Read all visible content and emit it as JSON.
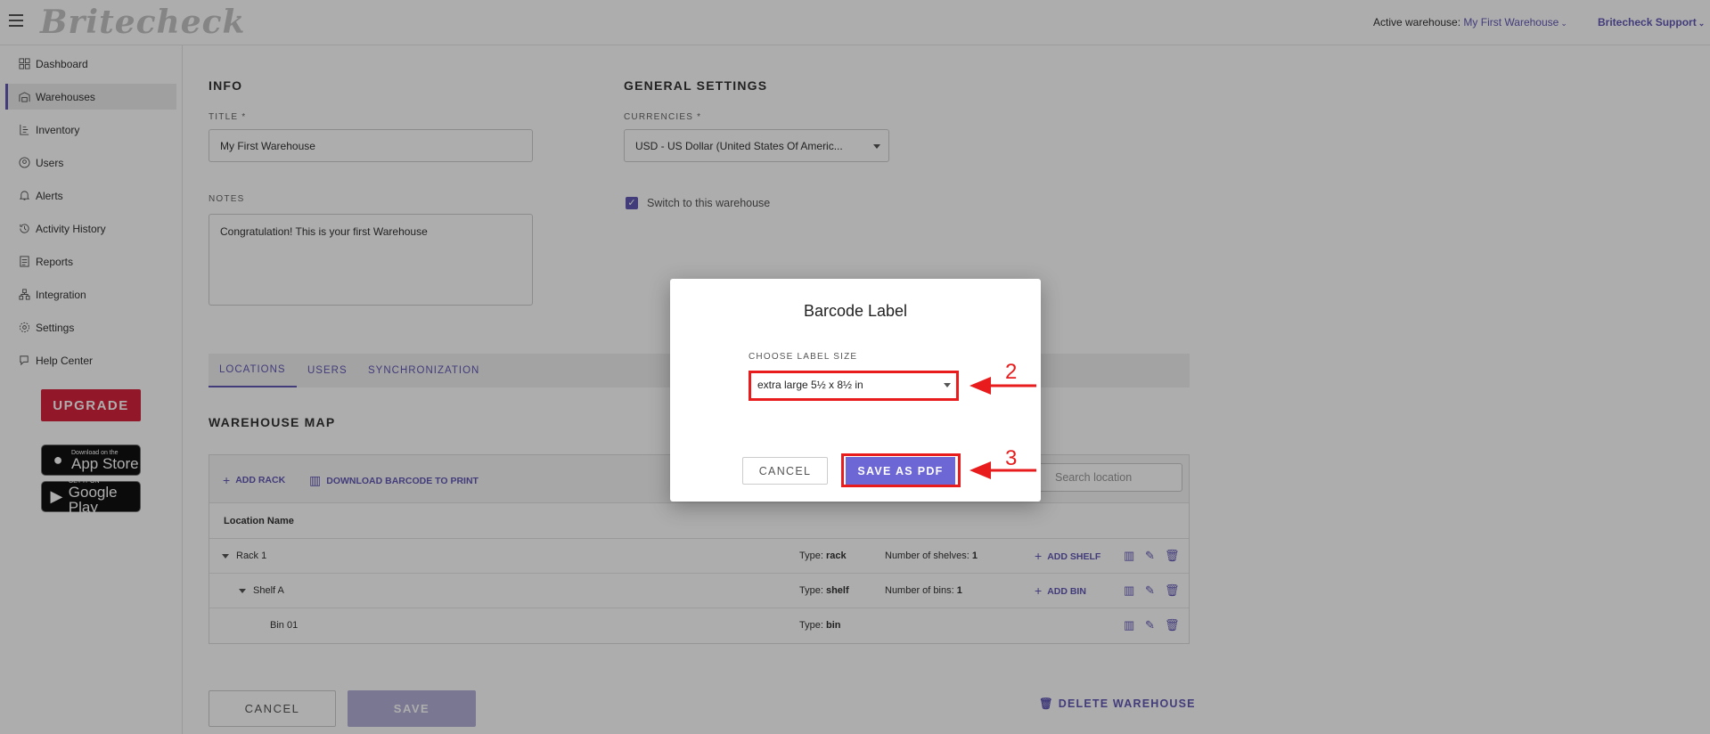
{
  "app": {
    "logo_text": "Britecheck",
    "active_warehouse_label": "Active warehouse:",
    "active_warehouse_value": "My First Warehouse",
    "support_label": "Britecheck Support"
  },
  "sidebar": {
    "items": [
      {
        "label": "Dashboard",
        "icon": "dashboard-icon"
      },
      {
        "label": "Warehouses",
        "icon": "warehouse-icon"
      },
      {
        "label": "Inventory",
        "icon": "inventory-icon"
      },
      {
        "label": "Users",
        "icon": "users-icon"
      },
      {
        "label": "Alerts",
        "icon": "bell-icon"
      },
      {
        "label": "Activity History",
        "icon": "history-icon"
      },
      {
        "label": "Reports",
        "icon": "reports-icon"
      },
      {
        "label": "Integration",
        "icon": "integration-icon"
      },
      {
        "label": "Settings",
        "icon": "gear-icon"
      },
      {
        "label": "Help Center",
        "icon": "help-icon"
      }
    ],
    "upgrade_label": "UPGRADE",
    "app_store": {
      "small": "Download on the",
      "big": "App Store"
    },
    "google_play": {
      "small": "GET IT ON",
      "big": "Google Play"
    }
  },
  "info": {
    "section_title": "INFO",
    "title_label": "TITLE *",
    "title_value": "My First Warehouse",
    "notes_label": "NOTES",
    "notes_value": "Congratulation! This is your first Warehouse"
  },
  "general": {
    "section_title": "GENERAL SETTINGS",
    "currencies_label": "CURRENCIES *",
    "currencies_value": "USD - US Dollar (United States Of Americ...",
    "switch_label": "Switch to this warehouse"
  },
  "tabs": [
    "LOCATIONS",
    "USERS",
    "SYNCHRONIZATION"
  ],
  "warehouse_map": {
    "title": "WAREHOUSE MAP",
    "add_rack": "ADD RACK",
    "download_barcode": "DOWNLOAD BARCODE TO PRINT",
    "search_placeholder": "Search location",
    "column_header": "Location Name",
    "rows": [
      {
        "name": "Rack 1",
        "type_label": "Type:",
        "type": "rack",
        "count_label": "Number of shelves:",
        "count": "1",
        "action": "ADD SHELF"
      },
      {
        "name": "Shelf A",
        "type_label": "Type:",
        "type": "shelf",
        "count_label": "Number of bins:",
        "count": "1",
        "action": "ADD BIN"
      },
      {
        "name": "Bin 01",
        "type_label": "Type:",
        "type": "bin"
      }
    ]
  },
  "footer": {
    "cancel": "CANCEL",
    "save": "SAVE",
    "delete": "DELETE WAREHOUSE"
  },
  "modal": {
    "title": "Barcode Label",
    "label": "CHOOSE LABEL SIZE",
    "selected": "extra large 5½ x 8½ in",
    "cancel": "CANCEL",
    "save_pdf": "SAVE AS PDF"
  },
  "annotations": [
    "2",
    "3"
  ],
  "colors": {
    "accent": "#6259b5",
    "upgrade": "#d8233b",
    "annotation": "#e81c1c",
    "primary_button": "#6d67d6"
  }
}
